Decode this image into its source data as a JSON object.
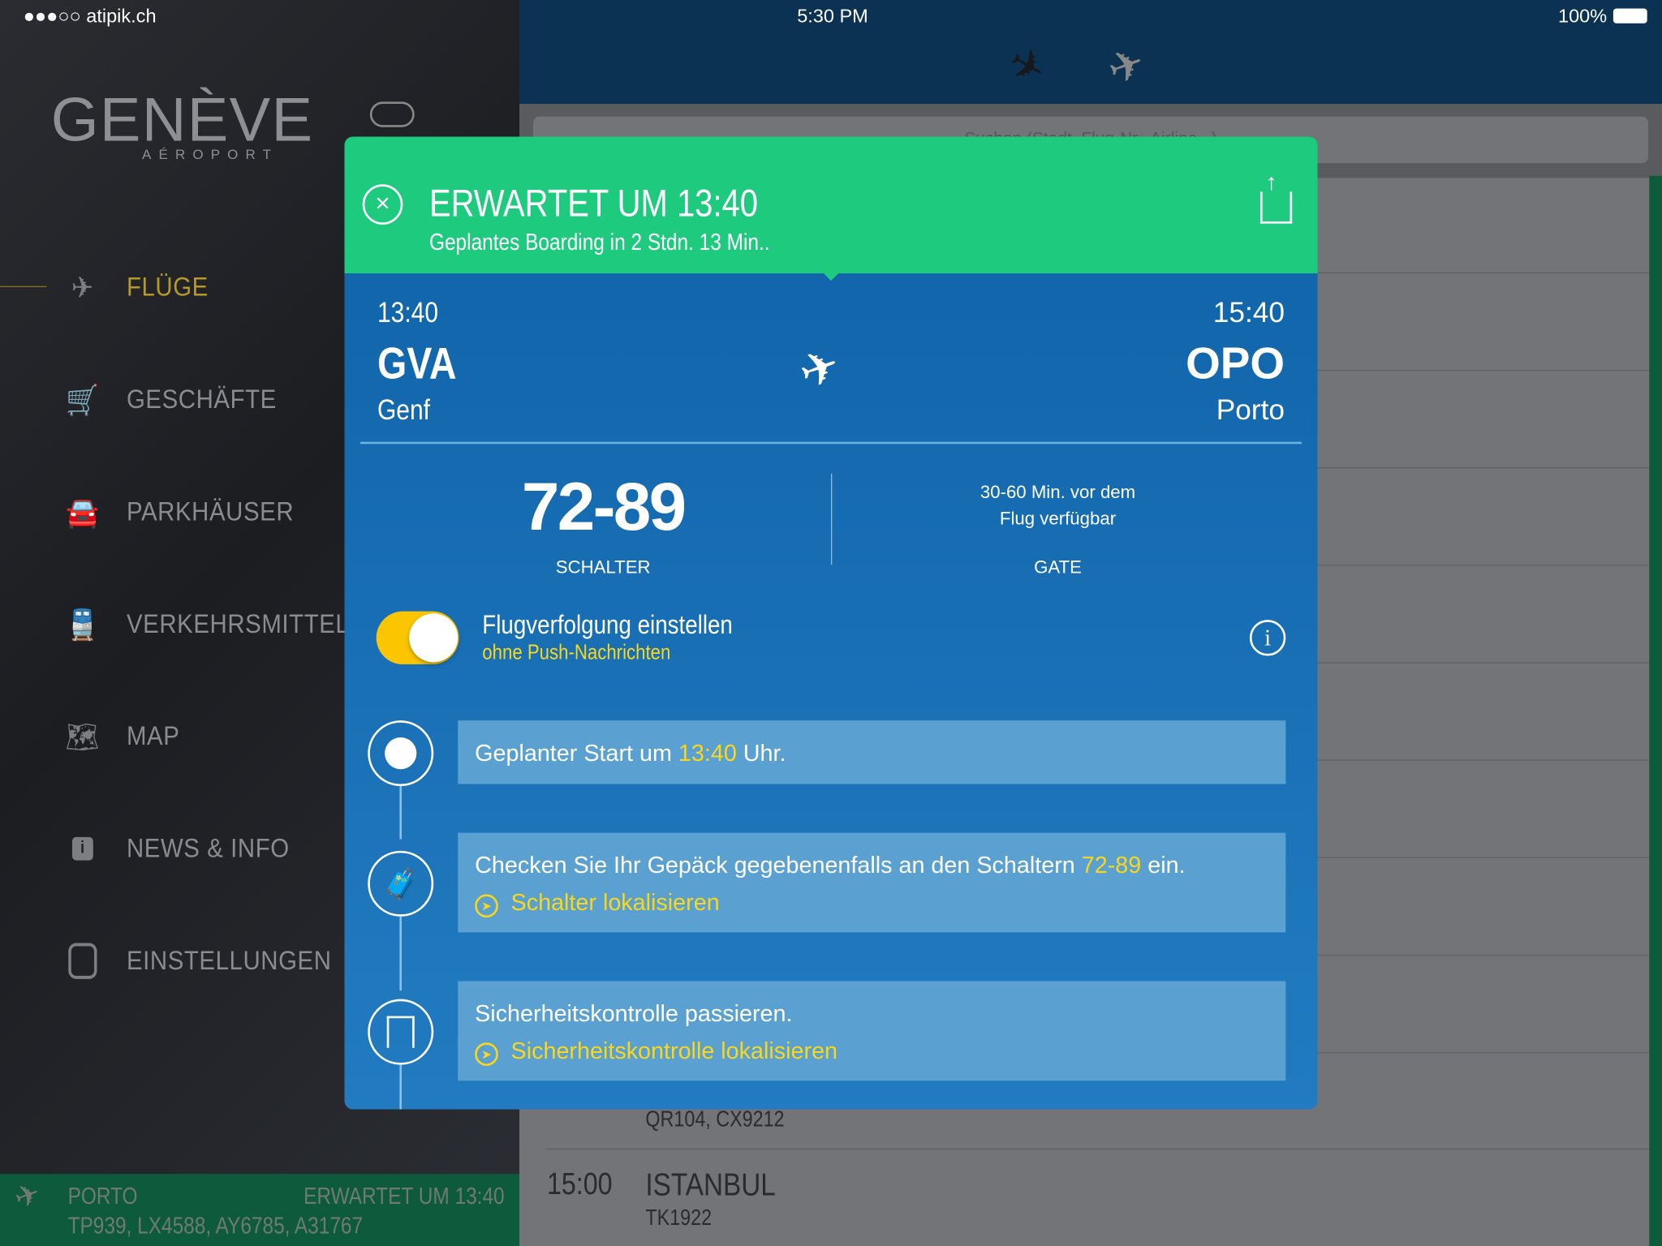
{
  "status_bar": {
    "carrier": "●●●○○ atipik.ch",
    "time": "5:30 PM",
    "battery": "100%"
  },
  "logo": {
    "name": "GENÈVE",
    "sub": "AÉROPORT"
  },
  "sidebar": {
    "items": [
      {
        "label": "FLÜGE",
        "icon": "airplane-icon",
        "active": true
      },
      {
        "label": "GESCHÄFTE",
        "icon": "cart-icon"
      },
      {
        "label": "PARKHÄUSER",
        "icon": "car-icon"
      },
      {
        "label": "VERKEHRSMITTEL",
        "icon": "train-icon"
      },
      {
        "label": "MAP",
        "icon": "map-icon"
      },
      {
        "label": "NEWS & INFO",
        "icon": "info-icon"
      },
      {
        "label": "EINSTELLUNGEN",
        "icon": "toggle-icon"
      }
    ]
  },
  "tracked_flight": {
    "destination": "PORTO",
    "status": "ERWARTET UM 13:40",
    "flights": "TP939, LX4588, AY6785, A31767"
  },
  "search": {
    "placeholder": "Suchen (Stadt, Flug-Nr., Airline...)"
  },
  "flight_list": [
    {
      "time": "",
      "city": "",
      "codes": "QR104, CX9212"
    },
    {
      "time": "15:00",
      "city": "ISTANBUL",
      "codes": "TK1922"
    }
  ],
  "modal": {
    "title": "ERWARTET UM 13:40",
    "subtitle": "Geplantes Boarding in 2 Stdn. 13 Min..",
    "departure": {
      "time": "13:40",
      "code": "GVA",
      "city": "Genf"
    },
    "arrival": {
      "time": "15:40",
      "code": "OPO",
      "city": "Porto"
    },
    "counter": {
      "value": "72-89",
      "label": "SCHALTER"
    },
    "gate": {
      "line1": "30-60 Min. vor dem",
      "line2": "Flug verfügbar",
      "label": "GATE"
    },
    "tracking": {
      "title": "Flugverfolgung einstellen",
      "subtitle": "ohne Push-Nachrichten",
      "enabled": true
    },
    "steps": [
      {
        "pre": "Geplanter Start um ",
        "hl": "13:40",
        "post": " Uhr.",
        "link": ""
      },
      {
        "pre": "Checken Sie Ihr Gepäck gegebenenfalls an den Schaltern ",
        "hl": "72-89",
        "post": " ein.",
        "link": "Schalter lokalisieren"
      },
      {
        "pre": "Sicherheitskontrolle passieren.",
        "hl": "",
        "post": "",
        "link": "Sicherheitskontrolle lokalisieren"
      }
    ]
  },
  "colors": {
    "header_green": "#1ecb7e",
    "modal_blue": "#1569b0",
    "highlight": "#f9d71c",
    "active_nav": "#b59a2a"
  }
}
